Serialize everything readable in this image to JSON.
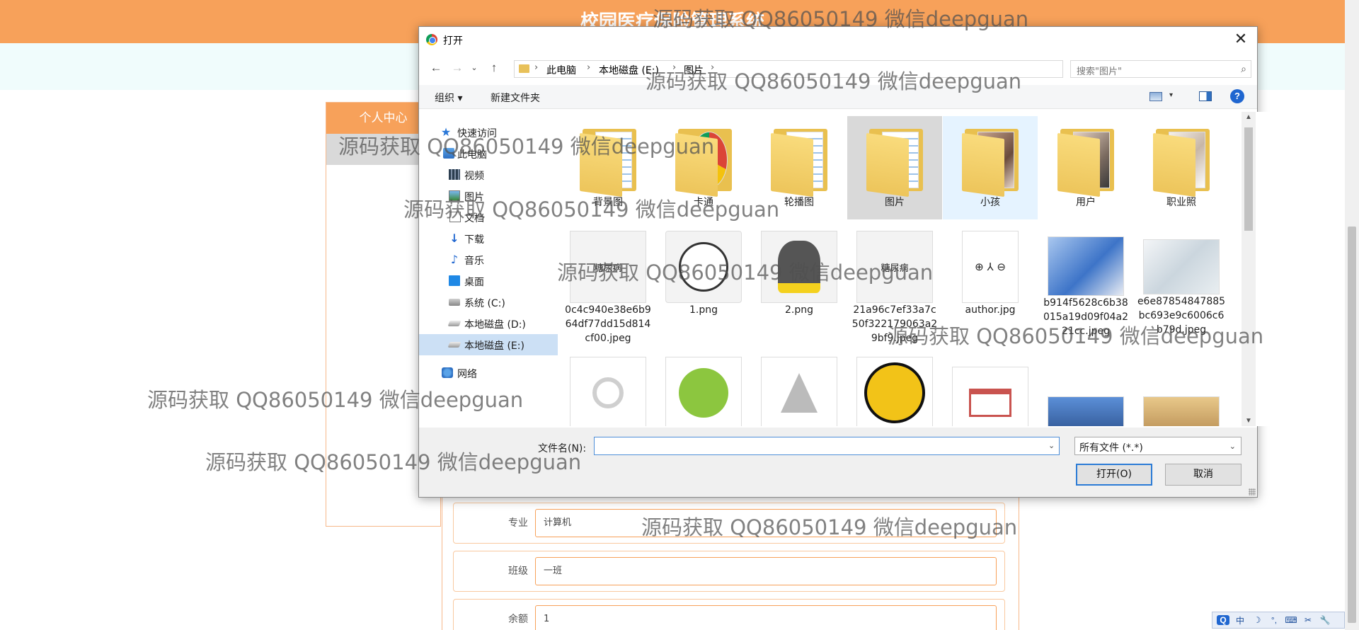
{
  "page": {
    "title": "校园医疗保险管理系统",
    "sidebar_header": "个人中心",
    "form_rows": [
      {
        "label": "专业",
        "value": "计算机"
      },
      {
        "label": "班级",
        "value": "一班"
      },
      {
        "label": "余额",
        "value": "1"
      }
    ]
  },
  "dialog": {
    "title": "打开",
    "close_glyph": "✕",
    "breadcrumbs": [
      "此电脑",
      "本地磁盘 (E:)",
      "图片"
    ],
    "search_placeholder": "搜索\"图片\"",
    "toolbar": {
      "organize": "组织 ▾",
      "new_folder": "新建文件夹",
      "help": "?"
    },
    "nav_items": [
      {
        "label": "快速访问",
        "icon": "star-icon"
      },
      {
        "label": "此电脑",
        "icon": "computer-icon"
      },
      {
        "label": "视频",
        "icon": "video-folder-icon"
      },
      {
        "label": "图片",
        "icon": "pictures-folder-icon"
      },
      {
        "label": "文档",
        "icon": "documents-folder-icon"
      },
      {
        "label": "下载",
        "icon": "download-icon"
      },
      {
        "label": "音乐",
        "icon": "music-icon"
      },
      {
        "label": "桌面",
        "icon": "desktop-icon"
      },
      {
        "label": "系统 (C:)",
        "icon": "system-drive-icon"
      },
      {
        "label": "本地磁盘 (D:)",
        "icon": "drive-icon"
      },
      {
        "label": "本地磁盘 (E:)",
        "icon": "drive-icon",
        "selected": true
      },
      {
        "label": "网络",
        "icon": "network-icon"
      }
    ],
    "folders": [
      {
        "name": "背景图"
      },
      {
        "name": "卡通"
      },
      {
        "name": "轮播图"
      },
      {
        "name": "图片",
        "state": "selected"
      },
      {
        "name": "小孩",
        "state": "hover"
      },
      {
        "name": "用户"
      },
      {
        "name": "职业照"
      }
    ],
    "files": [
      {
        "name": "0c4c940e38e6b964df77dd15d814cf00.jpeg",
        "caption": "糖尿病"
      },
      {
        "name": "1.png"
      },
      {
        "name": "2.png"
      },
      {
        "name": "21a96c7ef33a7c50f322179063a29bf9.jpeg",
        "caption": "糖尿病"
      },
      {
        "name": "author.jpg",
        "caption": "⊕ ⅄ ⊖"
      },
      {
        "name": "b914f5628c6b38015a19d09f04a221cc.jpeg"
      },
      {
        "name": "e6e87854847885bc693e9c6006c6b79d.jpeg"
      }
    ],
    "file_name_label": "文件名(N):",
    "file_name_value": "",
    "file_type": "所有文件 (*.*)",
    "open_button": "打开(O)",
    "cancel_button": "取消"
  },
  "ime": {
    "items": [
      "Q",
      "中",
      "☽",
      "°,",
      "⌨",
      "✂",
      "🔧"
    ]
  },
  "watermark": "源码获取 QQ86050149 微信deepguan"
}
